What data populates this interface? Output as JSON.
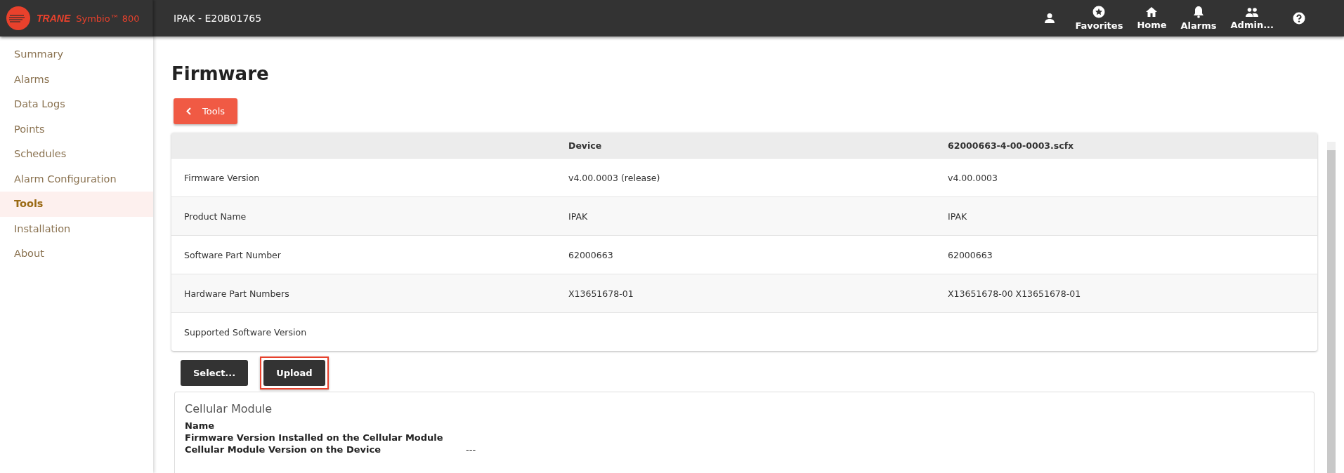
{
  "header": {
    "brand": "TRANE",
    "product": "Symbio™ 800",
    "device": "IPAK - E20B01765",
    "actions": [
      {
        "kind": "user"
      },
      {
        "kind": "favorites",
        "label": "Favorites"
      },
      {
        "kind": "home",
        "label": "Home"
      },
      {
        "kind": "alarms",
        "label": "Alarms"
      },
      {
        "kind": "admin",
        "label": "Admin..."
      },
      {
        "kind": "help"
      }
    ]
  },
  "sidebar": {
    "items": [
      {
        "label": "Summary",
        "selected": false
      },
      {
        "label": "Alarms",
        "selected": false
      },
      {
        "label": "Data Logs",
        "selected": false
      },
      {
        "label": "Points",
        "selected": false
      },
      {
        "label": "Schedules",
        "selected": false
      },
      {
        "label": "Alarm Configuration",
        "selected": false
      },
      {
        "label": "Tools",
        "selected": true
      },
      {
        "label": "Installation",
        "selected": false
      },
      {
        "label": "About",
        "selected": false
      }
    ]
  },
  "page": {
    "title": "Firmware",
    "back_button": "Tools"
  },
  "table": {
    "columns": [
      "",
      "Device",
      "62000663-4-00-0003.scfx"
    ],
    "rows": [
      [
        "Firmware Version",
        "v4.00.0003 (release)",
        "v4.00.0003"
      ],
      [
        "Product Name",
        "IPAK",
        "IPAK"
      ],
      [
        "Software Part Number",
        "62000663",
        "62000663"
      ],
      [
        "Hardware Part Numbers",
        "X13651678-01",
        "X13651678-00 X13651678-01"
      ],
      [
        "Supported Software Version",
        "",
        ""
      ]
    ]
  },
  "buttons": [
    {
      "label": "Select...",
      "highlighted": false
    },
    {
      "label": "Upload",
      "highlighted": true
    }
  ],
  "cellular": {
    "title": "Cellular Module",
    "fields": [
      {
        "label": "Name"
      },
      {
        "label": "Firmware Version Installed on the Cellular Module"
      },
      {
        "label": "Cellular Module Version on the Device",
        "value": "---"
      }
    ]
  }
}
